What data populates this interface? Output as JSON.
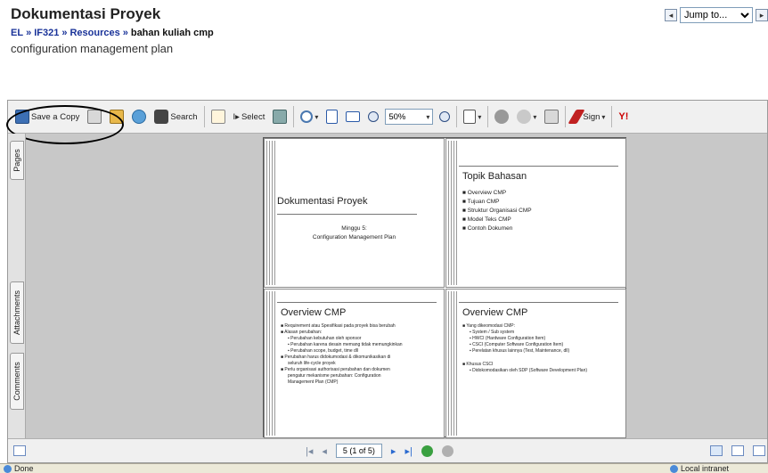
{
  "page": {
    "title": "Dokumentasi Proyek",
    "subtitle": "configuration management plan",
    "jump_label": "Jump to...",
    "breadcrumb": [
      "EL",
      "IF321",
      "Resources",
      "bahan kuliah cmp"
    ],
    "breadcrumb_sep": "»"
  },
  "toolbar": {
    "save_copy": "Save a Copy",
    "search": "Search",
    "select": "Select",
    "zoom": "50%",
    "sign": "Sign",
    "y_logo": "Y!"
  },
  "sidebar": {
    "tabs": [
      "Pages",
      "Attachments",
      "Comments"
    ]
  },
  "slides": {
    "s1": {
      "title": "Dokumentasi Proyek",
      "line1": "Minggu 5:",
      "line2": "Configuration Management Plan"
    },
    "s2": {
      "title": "Topik Bahasan",
      "items": [
        "Overview CMP",
        "Tujuan CMP",
        "Struktur Organisasi CMP",
        "Model Teks CMP",
        "Contoh Dokumen"
      ]
    },
    "s3": {
      "title": "Overview CMP",
      "b1": "Requirement atau Spesifikasi pada proyek bisa berubah",
      "b2": "Alasan perubahan:",
      "b2a": "Perubahan kebutuhan oleh sponsor",
      "b2b": "Perubahan karena desain memang tidak memungkinkan",
      "b2c": "Perubahan scope, budget, time dll",
      "b3": "Perubahan harus didokumodasi & dikomunikasikan di",
      "b3b": "seluruh life-cycle proyek",
      "b4": "Perlu organisasi authorisasi perubahan dan dokumen",
      "b4b": "pengatur mekanisme perubahan: Configuration",
      "b4c": "Management Plan (CMP)"
    },
    "s4": {
      "title": "Overview CMP",
      "b1": "Yang dikeomodasi CMP:",
      "b1a": "System / Sub system",
      "b1b": "HWCI (Hardware Configuration Item)",
      "b1c": "CSCI (Computer Software Configuration Item)",
      "b1d": "Perelatan khusus lainnya (Test, Maintenance, dll)",
      "b2": "Khusus CSCI",
      "b2a": "Didokomodasikan oleh SDP (Software Development Plan)"
    }
  },
  "navbar": {
    "page_box": "5 (1 of 5)"
  },
  "status": {
    "left": "Done",
    "right": "Local intranet"
  }
}
